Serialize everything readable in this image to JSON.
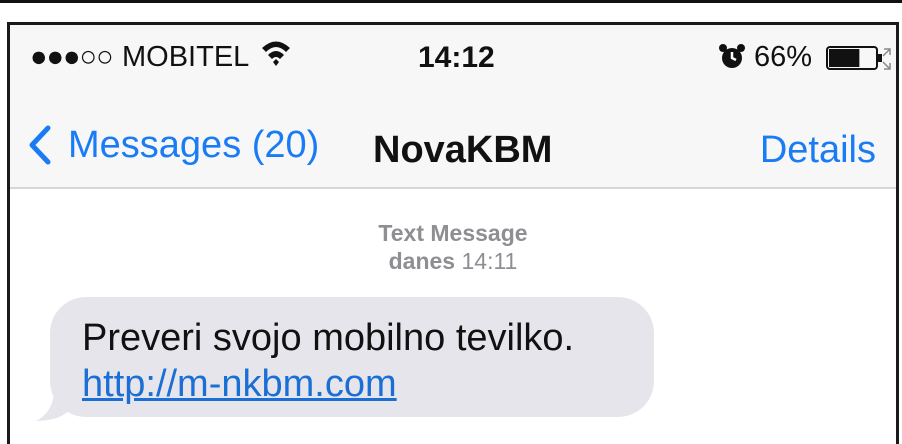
{
  "status_bar": {
    "signal": "●●●○○",
    "carrier": "MOBITEL",
    "time": "14:12",
    "battery_percent": "66%",
    "battery_level": 0.66,
    "icons": [
      "wifi-icon",
      "alarm-icon",
      "battery-icon"
    ]
  },
  "nav": {
    "back_label": "Messages (20)",
    "title": "NovaKBM",
    "details_label": "Details"
  },
  "thread": {
    "message_type": "Text Message",
    "date_prefix": "danes",
    "time": "14:11"
  },
  "message": {
    "text": "Preveri svojo mobilno  tevilko.",
    "link": "http://m-nkbm.com"
  },
  "colors": {
    "accent": "#1a7cf5",
    "bubble": "#e6e5eb",
    "link": "#1a6fd6",
    "meta": "#8e8e93"
  }
}
